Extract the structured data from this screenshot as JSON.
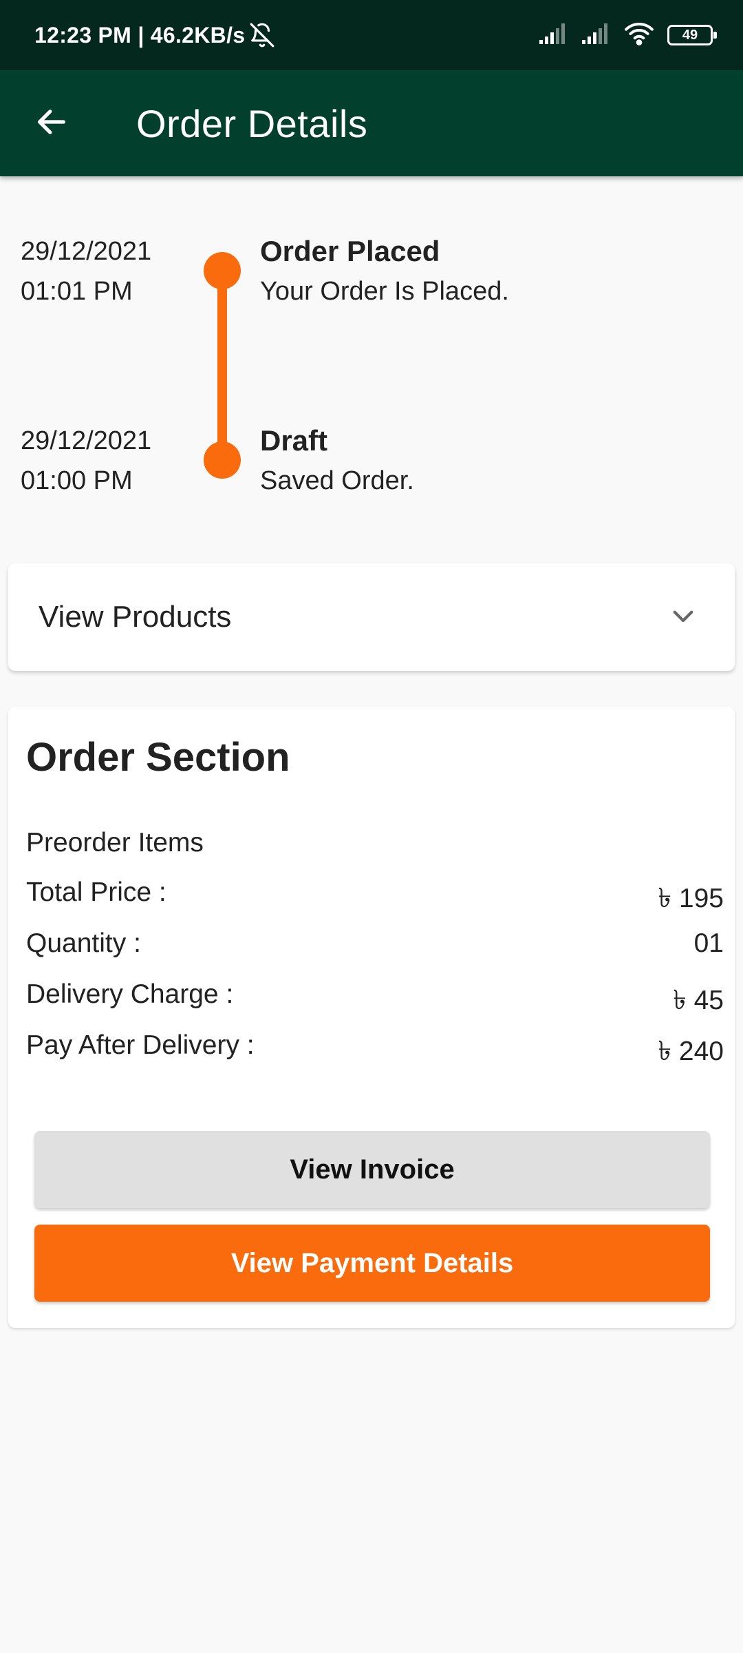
{
  "status_bar": {
    "time_speed": "12:23 PM | 46.2KB/s",
    "battery": "49"
  },
  "app_bar": {
    "title": "Order Details"
  },
  "timeline": [
    {
      "date": "29/12/2021",
      "time": "01:01 PM",
      "title": "Order Placed",
      "desc": "Your Order Is Placed."
    },
    {
      "date": "29/12/2021",
      "time": "01:00 PM",
      "title": "Draft",
      "desc": "Saved Order."
    }
  ],
  "products": {
    "label": "View Products"
  },
  "order_section": {
    "title": "Order Section",
    "subtitle": "Preorder Items",
    "rows": [
      {
        "label": "Total Price :",
        "value": "৳ 195"
      },
      {
        "label": "Quantity :",
        "value": "01"
      },
      {
        "label": "Delivery Charge :",
        "value": "৳ 45"
      },
      {
        "label": "Pay After Delivery :",
        "value": "৳ 240"
      }
    ],
    "invoice_button": "View Invoice",
    "payment_button": "View Payment Details"
  },
  "colors": {
    "status_bar": "#04281d",
    "app_bar": "#033f2d",
    "accent_orange": "#f96b0c",
    "invoice_button": "#e0e0e0"
  }
}
